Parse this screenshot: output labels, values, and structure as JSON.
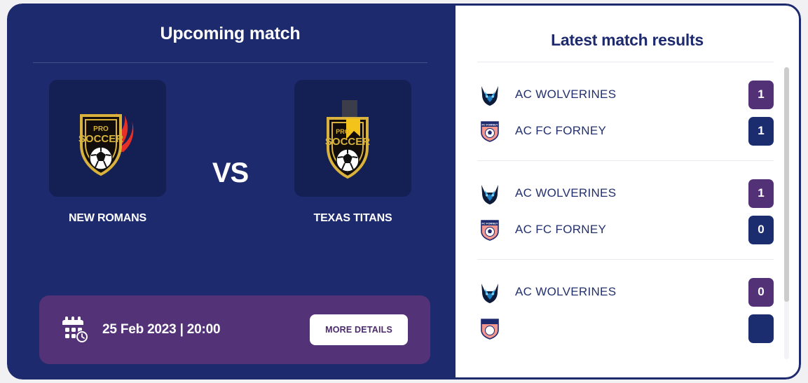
{
  "theme": {
    "panel_blue": "#1e2a6e",
    "tile_blue": "#141f54",
    "purple": "#543277",
    "badge_home_purple": "#533176",
    "badge_away_navy": "#1b2c6f",
    "page_background": "#f1f1f4",
    "crest_gold": "#d8b23c"
  },
  "upcoming": {
    "title": "Upcoming match",
    "vs_label": "VS",
    "home_team": {
      "name": "NEW ROMANS",
      "crest": "pro-soccer-flame-crest-icon"
    },
    "away_team": {
      "name": "TEXAS TITANS",
      "crest": "pro-soccer-banner-crest-icon"
    },
    "date_icon": "calendar-clock-icon",
    "date_text": "25 Feb 2023 | 20:00",
    "details_button": "MORE DETAILS"
  },
  "results": {
    "title": "Latest match results",
    "scrollbar": "vertical-scrollbar",
    "matches": [
      {
        "home": {
          "club": "AC WOLVERINES",
          "logo": "wolverine-head-icon",
          "score": "1"
        },
        "away": {
          "club": "AC FC FORNEY",
          "logo": "fc-forney-shield-icon",
          "score": "1"
        }
      },
      {
        "home": {
          "club": "AC WOLVERINES",
          "logo": "wolverine-head-icon",
          "score": "1"
        },
        "away": {
          "club": "AC FC FORNEY",
          "logo": "fc-forney-shield-icon",
          "score": "0"
        }
      },
      {
        "home": {
          "club": "AC WOLVERINES",
          "logo": "wolverine-head-icon",
          "score": "0"
        },
        "away": {
          "club": "",
          "logo": "fc-forney-shield-icon",
          "score": ""
        }
      }
    ]
  }
}
